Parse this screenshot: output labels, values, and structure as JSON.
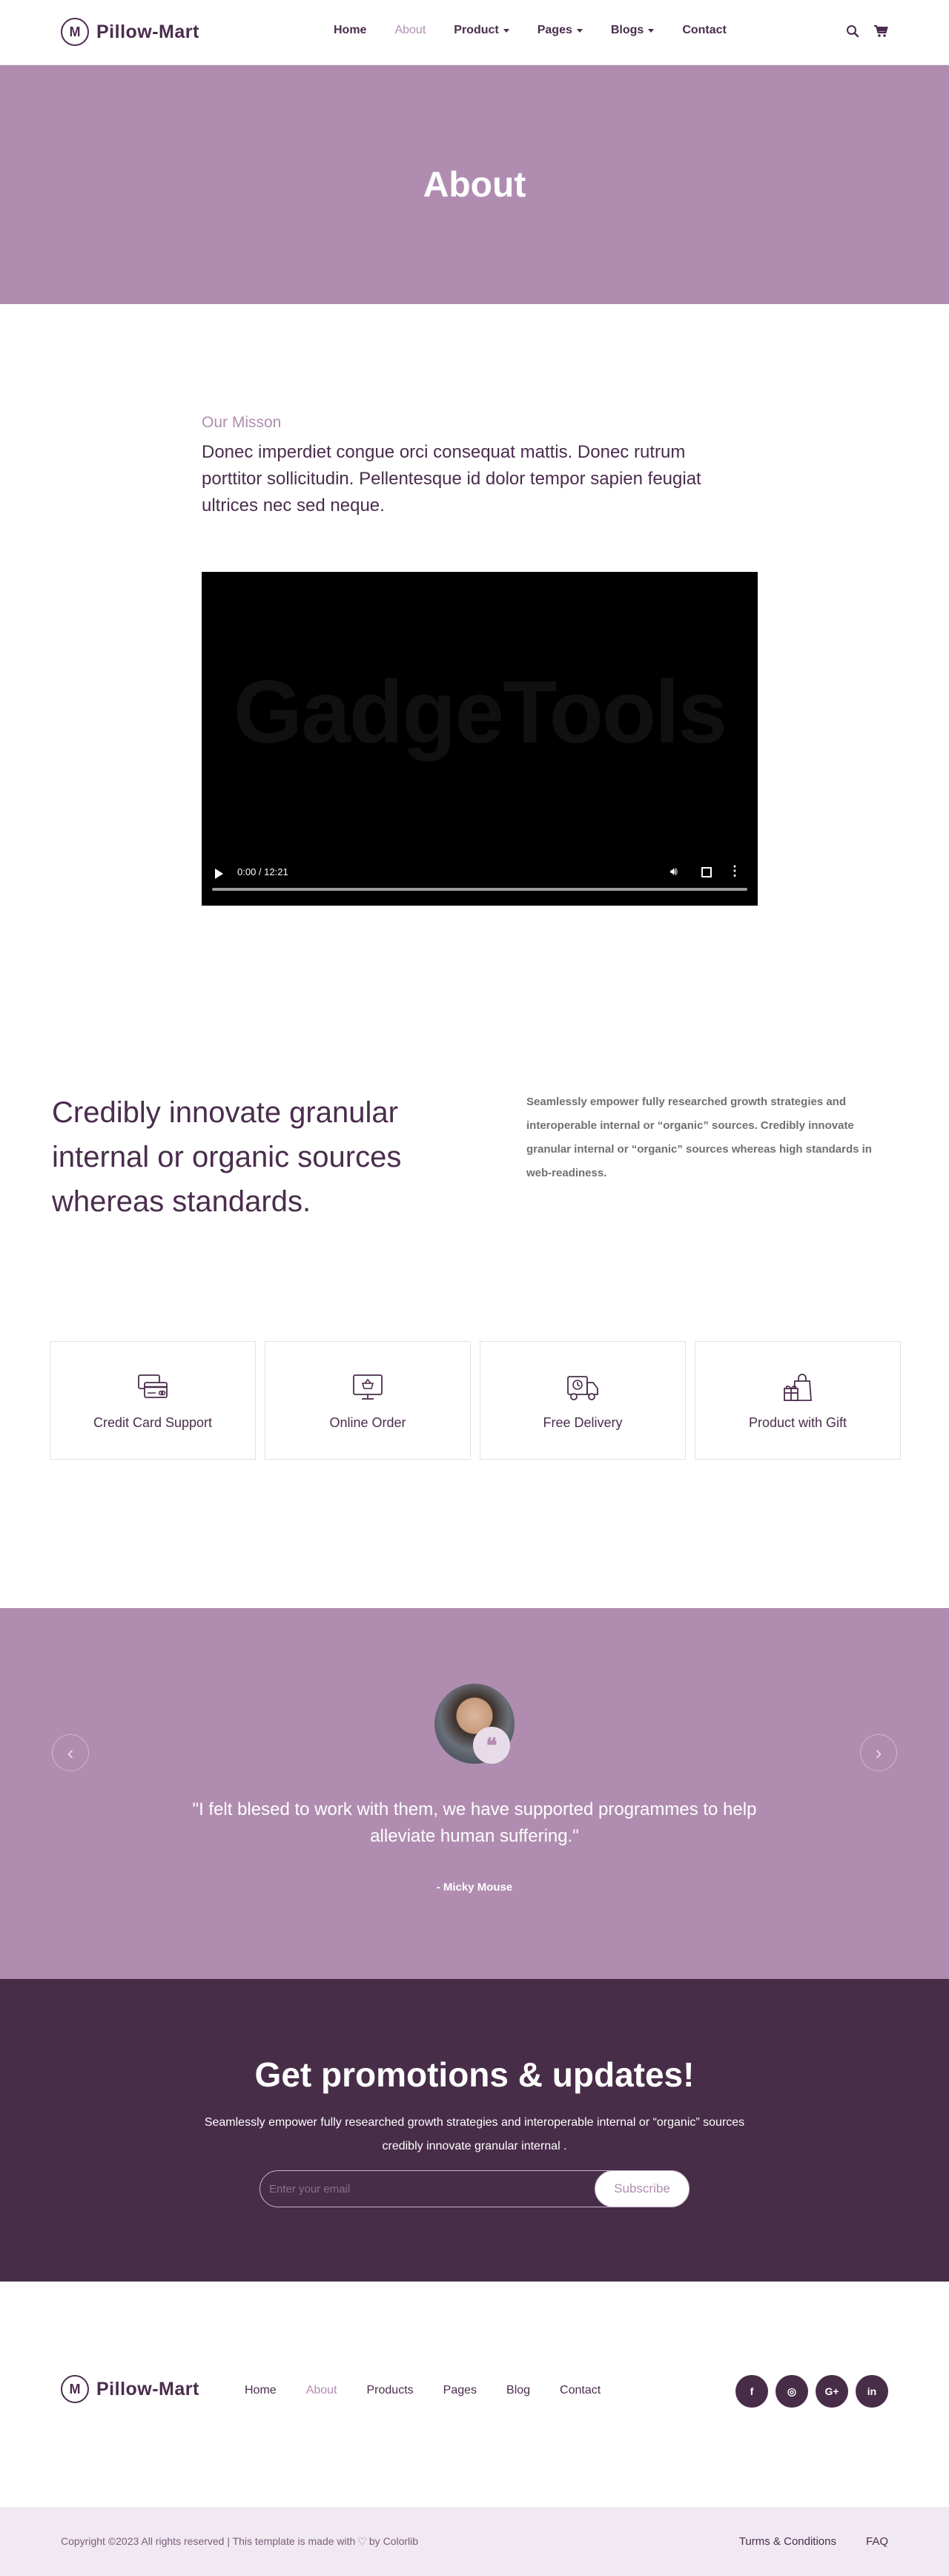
{
  "brand": {
    "name": "Pillow-Mart",
    "logo_glyph": "M"
  },
  "nav": {
    "items": [
      {
        "label": "Home",
        "active": false,
        "dropdown": false
      },
      {
        "label": "About",
        "active": true,
        "dropdown": false
      },
      {
        "label": "Product",
        "active": false,
        "dropdown": true
      },
      {
        "label": "Pages",
        "active": false,
        "dropdown": true
      },
      {
        "label": "Blogs",
        "active": false,
        "dropdown": true
      },
      {
        "label": "Contact",
        "active": false,
        "dropdown": false
      }
    ],
    "icons": [
      "search-icon",
      "cart-icon"
    ]
  },
  "banner": {
    "title": "About"
  },
  "mission": {
    "label": "Our Misson",
    "text": "Donec imperdiet congue orci consequat mattis. Donec rutrum porttitor sollicitudin. Pellentesque id dolor tempor sapien feugiat ultrices nec sed neque."
  },
  "video": {
    "watermark": "GadgeTools",
    "time": "0:00 / 12:21",
    "progress": 0
  },
  "credibly": {
    "heading": "Credibly innovate granular internal or organic sources whereas standards.",
    "text": "Seamlessly empower fully researched growth strategies and interoperable internal or “organic” sources. Credibly innovate granular internal or “organic” sources whereas high standards in web-readiness."
  },
  "features": [
    {
      "label": "Credit Card Support",
      "icon": "credit-card-icon"
    },
    {
      "label": "Online Order",
      "icon": "online-order-icon"
    },
    {
      "label": "Free Delivery",
      "icon": "delivery-truck-icon"
    },
    {
      "label": "Product with Gift",
      "icon": "gift-bag-icon"
    }
  ],
  "testimonial": {
    "quote": "\"I felt blesed to work with them, we have supported programmes to help alleviate human suffering.\"",
    "author": "- Micky Mouse",
    "quote_glyph": "❝"
  },
  "newsletter": {
    "title": "Get promotions & updates!",
    "text": "Seamlessly empower fully researched growth strategies and interoperable internal or “organic” sources credibly innovate granular internal .",
    "placeholder": "Enter your email",
    "button": "Subscribe"
  },
  "footer": {
    "nav": [
      {
        "label": "Home",
        "active": false
      },
      {
        "label": "About",
        "active": true
      },
      {
        "label": "Products",
        "active": false
      },
      {
        "label": "Pages",
        "active": false
      },
      {
        "label": "Blog",
        "active": false
      },
      {
        "label": "Contact",
        "active": false
      }
    ],
    "socials": [
      {
        "icon": "facebook-icon",
        "glyph": "f"
      },
      {
        "icon": "instagram-icon",
        "glyph": "◎"
      },
      {
        "icon": "google-plus-icon",
        "glyph": "G+"
      },
      {
        "icon": "linkedin-icon",
        "glyph": "in"
      }
    ],
    "copyright_pre": "Copyright ©2023 All rights reserved | This template is made with",
    "copyright_post": "by Colorlib",
    "links": [
      "Turms & Conditions",
      "FAQ"
    ]
  },
  "colors": {
    "accent": "#b08db0",
    "dark": "#482d48",
    "text": "#4a2d4d"
  }
}
